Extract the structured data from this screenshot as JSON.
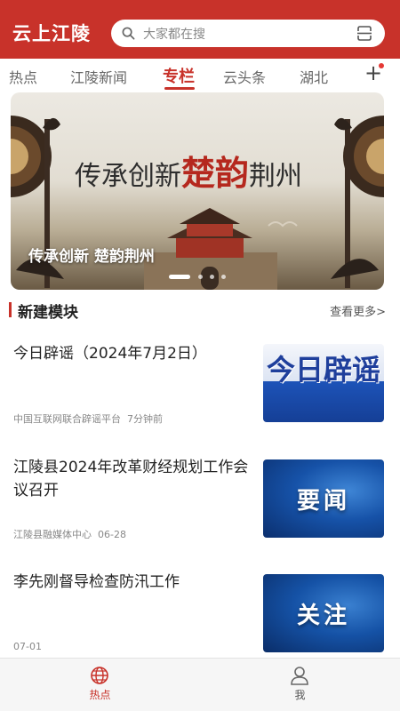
{
  "header": {
    "app_title": "云上江陵",
    "search_placeholder": "大家都在搜",
    "icons": {
      "search": "search-icon",
      "scan": "scan-icon"
    },
    "brand_color": "#c8322a"
  },
  "tabs": {
    "items": [
      {
        "label": "热点",
        "active": false
      },
      {
        "label": "江陵新闻",
        "active": false
      },
      {
        "label": "专栏",
        "active": true
      },
      {
        "label": "云头条",
        "active": false
      },
      {
        "label": "湖北",
        "active": false
      }
    ],
    "add_label": "+"
  },
  "banner": {
    "headline_prefix": "传承创新",
    "headline_highlight": "楚韵",
    "headline_suffix": "荆州",
    "caption": "传承创新 楚韵荆州",
    "slide_count": 4,
    "active_slide": 1
  },
  "section": {
    "title": "新建模块",
    "more_label": "查看更多>"
  },
  "news": [
    {
      "title": "今日辟谣（2024年7月2日）",
      "source": "中国互联网联合辟谣平台",
      "time": "7分钟前",
      "thumb_text": "今日辟谣"
    },
    {
      "title": "江陵县2024年改革财经规划工作会议召开",
      "source": "江陵县融媒体中心",
      "time": "06-28",
      "thumb_text": "要闻"
    },
    {
      "title": "李先刚督导检查防汛工作",
      "source": "",
      "time": "07-01",
      "thumb_text": "关注"
    }
  ],
  "bottom_nav": {
    "items": [
      {
        "label": "热点",
        "icon": "globe-icon",
        "active": true
      },
      {
        "label": "我",
        "icon": "user-icon",
        "active": false
      }
    ]
  }
}
